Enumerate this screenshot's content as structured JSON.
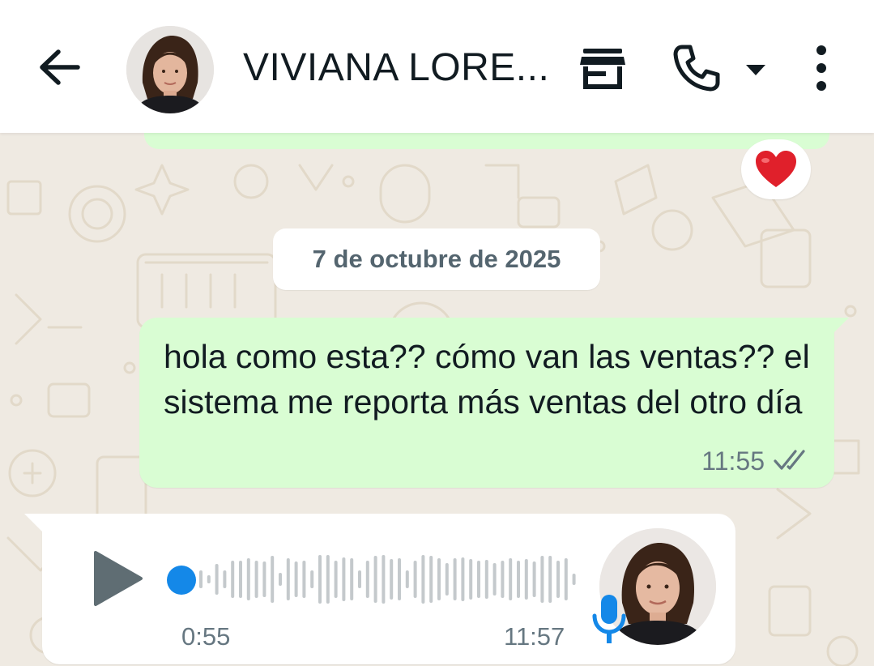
{
  "header": {
    "contact_name": "VIVIANA LORE...",
    "icons": {
      "back": "arrow-left-icon",
      "avatar": "contact-avatar",
      "shop": "storefront-icon",
      "call": "phone-icon",
      "call_options": "caret-down-icon",
      "menu": "vertical-dots-icon"
    }
  },
  "chat": {
    "reaction_emoji": "heart",
    "date_separator": "7 de octubre de 2025",
    "outgoing_message": {
      "text": "hola como esta?? cómo van las ventas?? el sistema me reporta más ventas del otro día",
      "time": "11:55",
      "status": "read"
    },
    "incoming_voice_note": {
      "duration": "0:55",
      "time": "11:57",
      "played_fraction": 0.0
    }
  },
  "colors": {
    "outgoing_bubble": "#d9fdd3",
    "incoming_bubble": "#ffffff",
    "chat_background": "#efeae2",
    "accent_blue": "#1488e8",
    "heart_red": "#e0202b"
  }
}
